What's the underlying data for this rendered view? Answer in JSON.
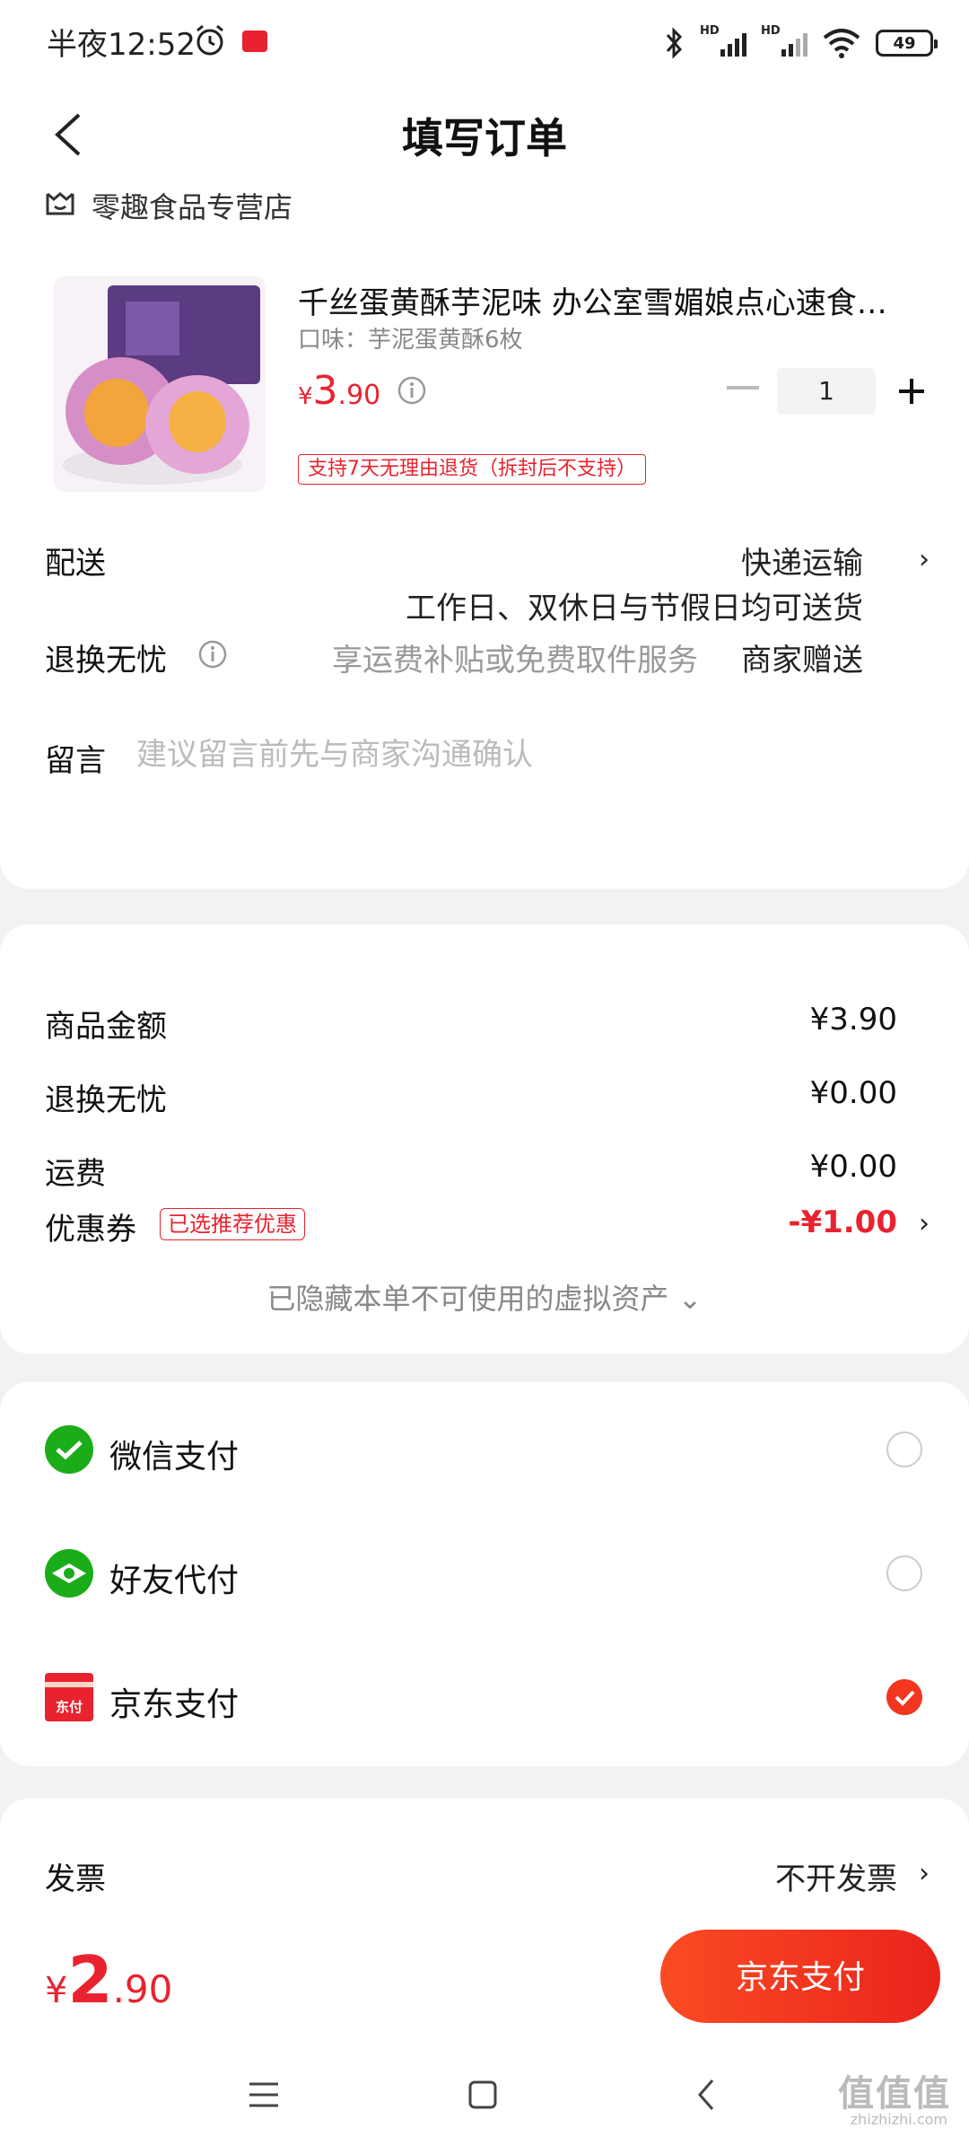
{
  "status_bar": {
    "time": "半夜12:52",
    "hd1": "HD",
    "hd2": "HD",
    "battery": "49"
  },
  "header": {
    "title": "填写订单"
  },
  "store": {
    "name": "零趣食品专营店"
  },
  "product": {
    "title": "千丝蛋黄酥芋泥味 办公室雪媚娘点心速食…",
    "spec": "口味：芋泥蛋黄酥6枚",
    "price_yen": "¥",
    "price_int": "3",
    "price_dec": ".90",
    "quantity": "1",
    "return_tag": "支持7天无理由退货（拆封后不支持）"
  },
  "delivery": {
    "label": "配送",
    "method": "快递运输",
    "note": "工作日、双休日与节假日均可送货"
  },
  "return_service": {
    "label": "退换无忧",
    "desc": "享运费补贴或免费取件服务",
    "value": "商家赠送"
  },
  "message": {
    "label": "留言",
    "placeholder": "建议留言前先与商家沟通确认"
  },
  "fees": {
    "goods_label": "商品金额",
    "goods_value": "¥3.90",
    "return_label": "退换无忧",
    "return_value": "¥0.00",
    "shipping_label": "运费",
    "shipping_value": "¥0.00",
    "coupon_label": "优惠券",
    "coupon_tag": "已选推荐优惠",
    "coupon_value": "-¥1.00",
    "hidden_assets": "已隐藏本单不可使用的虚拟资产 ⌄"
  },
  "payment": {
    "options": [
      {
        "label": "微信支付",
        "selected": false
      },
      {
        "label": "好友代付",
        "selected": false
      },
      {
        "label": "京东支付",
        "selected": true
      }
    ],
    "jd_icon_text": "东付"
  },
  "invoice": {
    "label": "发票",
    "value": "不开发票"
  },
  "footer": {
    "total_yen": "¥",
    "total_int": "2",
    "total_dec": ".90",
    "pay_button": "京东支付"
  },
  "watermark": {
    "text": "值值值",
    "sub": "zhizhizhi.com"
  },
  "colors": {
    "accent": "#e8232f",
    "pay_button": "#f2361f",
    "wechat": "#1aad19"
  }
}
